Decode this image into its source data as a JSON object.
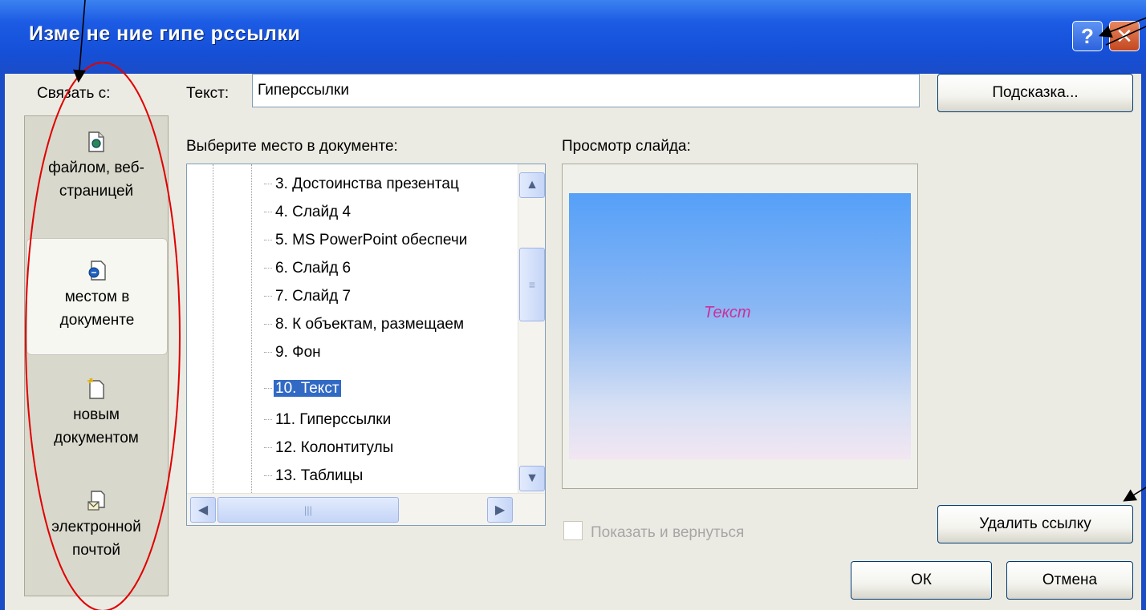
{
  "dialog": {
    "title": "Изме не ние гипе рссылки",
    "help_icon": "help-icon",
    "close_icon": "close-icon"
  },
  "link_with": {
    "label": "Связать с:",
    "items": [
      {
        "label": "файлом, веб-страницей",
        "icon": "web-page-icon",
        "selected": false
      },
      {
        "label": "местом в документе",
        "icon": "place-in-document-icon",
        "selected": true
      },
      {
        "label": "новым документом",
        "icon": "new-document-icon",
        "selected": false
      },
      {
        "label": "электронной почтой",
        "icon": "email-icon",
        "selected": false
      }
    ]
  },
  "text_field": {
    "label": "Текст:",
    "value": "Гиперссылки"
  },
  "hint_button": "Подсказка...",
  "place": {
    "label": "Выберите место в документе:",
    "items": [
      "3. Достоинства презентац",
      "4. Слайд 4",
      "5. MS PowerPoint обеспечи",
      "6. Слайд 6",
      "7. Слайд 7",
      "8. К объектам, размещаем",
      "9. Фон",
      "10. Текст",
      "11. Гиперссылки",
      "12. Колонтитулы",
      "13. Таблицы"
    ],
    "selected_index": 7
  },
  "preview": {
    "label": "Просмотр слайда:",
    "slide_text": "Текст"
  },
  "show_and_return": {
    "label": "Показать и вернуться",
    "checked": false
  },
  "buttons": {
    "remove_link": "Удалить ссылку",
    "ok": "ОК",
    "cancel": "Отмена"
  },
  "colors": {
    "titlebar": "#1c5be4",
    "dialog_bg": "#ecebe3",
    "selection": "#316ac5",
    "slide_text": "#cc2f9a",
    "annotation": "#e00000"
  }
}
